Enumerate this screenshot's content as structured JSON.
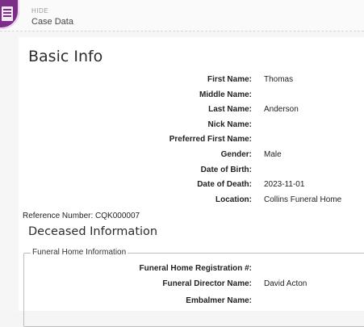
{
  "header": {
    "hide_label": "HIDE",
    "case_data_label": "Case Data",
    "icon": "case-document-icon",
    "icon_color": "#7b2f86"
  },
  "basic_info": {
    "title": "Basic Info",
    "fields": [
      {
        "label": "First Name:",
        "value": "Thomas"
      },
      {
        "label": "Middle Name:",
        "value": ""
      },
      {
        "label": "Last Name:",
        "value": "Anderson"
      },
      {
        "label": "Nick Name:",
        "value": ""
      },
      {
        "label": "Preferred First Name:",
        "value": ""
      },
      {
        "label": "Gender:",
        "value": "Male"
      },
      {
        "label": "Date of Birth:",
        "value": ""
      },
      {
        "label": "Date of Death:",
        "value": "2023-11-01"
      },
      {
        "label": "Location:",
        "value": "Collins Funeral Home"
      }
    ]
  },
  "reference_number": "Reference Number: CQK000007",
  "deceased_info": {
    "title": "Deceased Information",
    "funeral_home": {
      "legend": "Funeral Home Information",
      "fields": [
        {
          "label": "Funeral Home Registration #:",
          "value": ""
        },
        {
          "label": "Funeral Director Name:",
          "value": "David Acton"
        },
        {
          "label": "Embalmer Name:",
          "value": ""
        }
      ]
    }
  }
}
